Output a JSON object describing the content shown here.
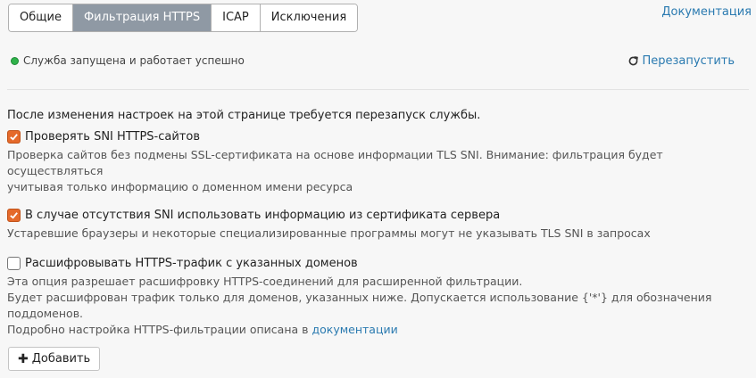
{
  "tabs": [
    {
      "label": "Общие",
      "active": false
    },
    {
      "label": "Фильтрация HTTPS",
      "active": true
    },
    {
      "label": "ICAP",
      "active": false
    },
    {
      "label": "Исключения",
      "active": false
    }
  ],
  "doc_link": "Документация",
  "status": {
    "text": "Служба запущена и работает успешно",
    "color": "#2fb24a"
  },
  "restart_label": "Перезапустить",
  "notice": "После изменения настроек на этой странице требуется перезапуск службы.",
  "options": [
    {
      "checked": true,
      "label": "Проверять SNI HTTPS-сайтов",
      "desc": [
        "Проверка сайтов без подмены SSL-сертификата на основе информации TLS SNI. Внимание: фильтрация будет осуществляться",
        "учитывая только информацию о доменном имени ресурса"
      ]
    },
    {
      "checked": true,
      "label": "В случае отсутствия SNI использовать информацию из сертификата сервера",
      "desc": [
        "Устаревшие браузеры и некоторые специализированные программы могут не указывать TLS SNI в запросах"
      ]
    },
    {
      "checked": false,
      "label": "Расшифровывать HTTPS-трафик с указанных доменов",
      "desc": [
        "Эта опция разрешает расшифровку HTTPS-соединений для расширенной фильтрации.",
        "Будет расшифрован трафик только для доменов, указанных ниже. Допускается использование {'*'} для обозначения поддоменов."
      ],
      "desc_link_prefix": "Подробно настройка HTTPS-фильтрации описана в ",
      "desc_link": "документации"
    }
  ],
  "add_button": "Добавить",
  "colors": {
    "accent": "#e56a2b",
    "link": "#2a7ab0",
    "active_tab": "#8f99a4"
  }
}
